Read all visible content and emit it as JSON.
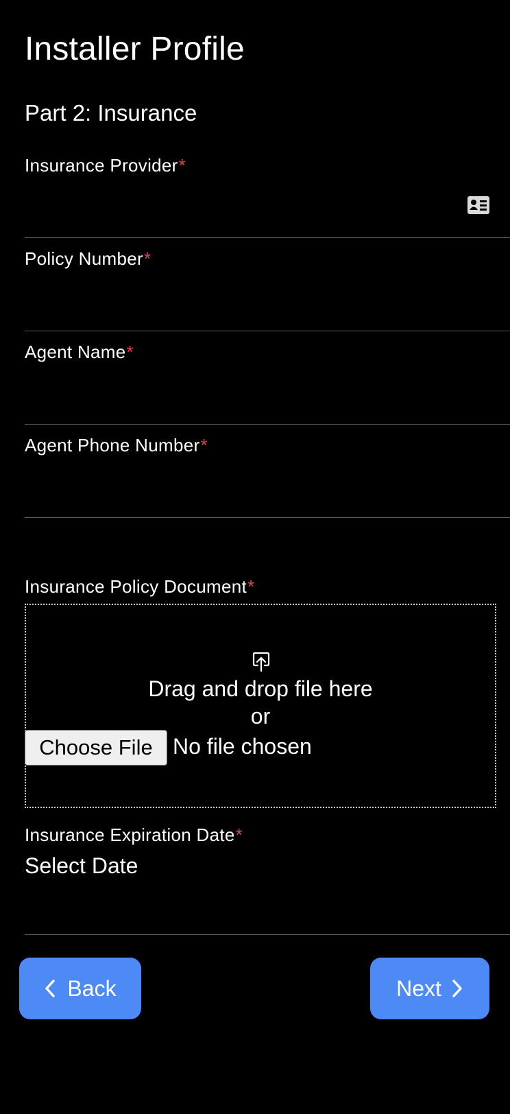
{
  "header": {
    "title": "Installer Profile",
    "section": "Part 2: Insurance"
  },
  "fields": {
    "provider": {
      "label": "Insurance Provider",
      "required_mark": "*",
      "value": ""
    },
    "policy": {
      "label": "Policy Number",
      "required_mark": "*",
      "value": ""
    },
    "agent_name": {
      "label": "Agent Name",
      "required_mark": "*",
      "value": ""
    },
    "agent_phone": {
      "label": "Agent Phone Number",
      "required_mark": "*",
      "value": ""
    }
  },
  "document": {
    "label": "Insurance Policy Document",
    "required_mark": "*",
    "drop_text": "Drag and drop file here",
    "or_text": "or",
    "choose_label": "Choose File",
    "no_file_text": "No file chosen"
  },
  "expiration": {
    "label": "Insurance Expiration Date",
    "required_mark": "*",
    "value": "Select Date"
  },
  "nav": {
    "back_label": "Back",
    "next_label": "Next"
  },
  "colors": {
    "accent": "#4d8af5",
    "required": "#e53e52",
    "background": "#000000",
    "divider": "#5c5c5c"
  },
  "icons": {
    "provider_field": "contact-card-icon",
    "dropzone": "upload-icon",
    "back": "chevron-left-icon",
    "next": "chevron-right-icon"
  }
}
